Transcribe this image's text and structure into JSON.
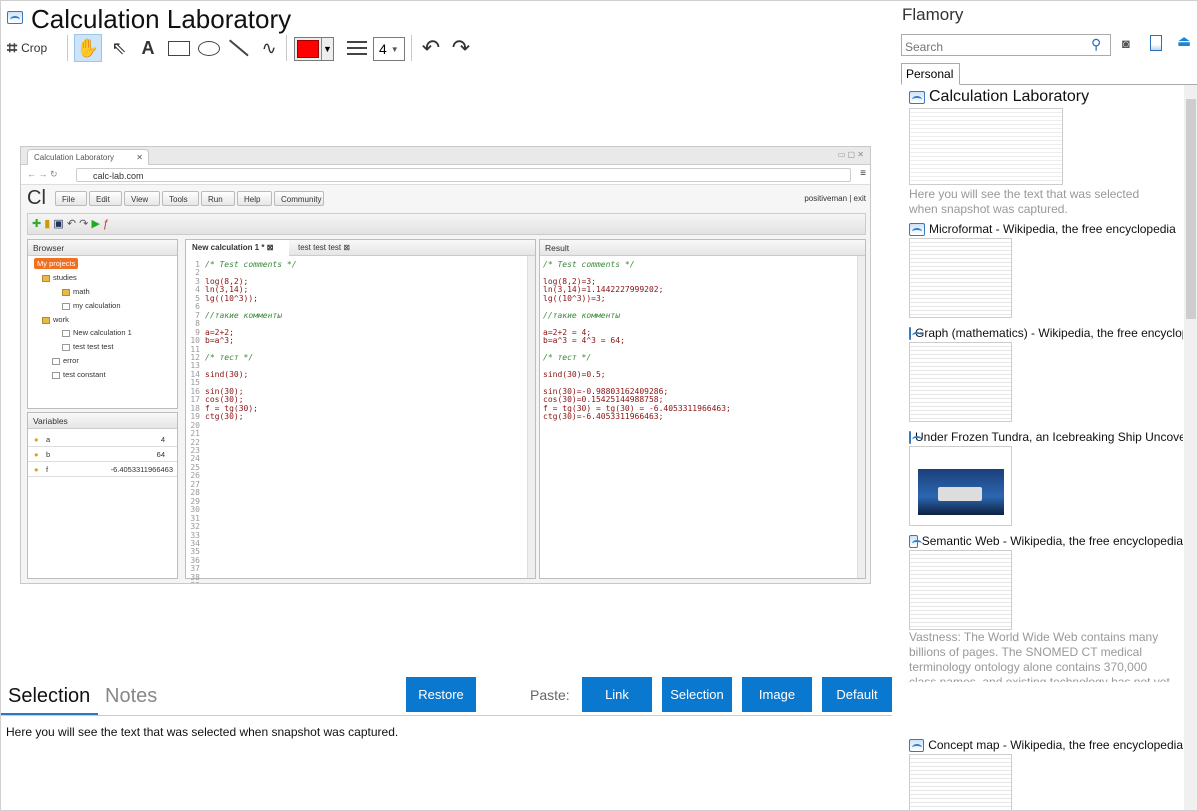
{
  "window": {
    "title": "Calculation Laboratory"
  },
  "toolbar": {
    "crop_label": "Crop",
    "line_width": "4",
    "stroke_color": "#ff0000",
    "icons": [
      "crop-icon",
      "hand-icon",
      "pointer-icon",
      "text-icon",
      "rectangle-icon",
      "ellipse-icon",
      "line-icon",
      "freehand-icon",
      "color-dropdown",
      "line-width-icon",
      "undo-icon",
      "redo-icon"
    ]
  },
  "snapshot": {
    "tab_title": "Calculation Laboratory",
    "url": "calc-lab.com",
    "logo": "Cl",
    "menu": [
      "File",
      "Edit",
      "View",
      "Tools",
      "Run",
      "Help",
      "Community"
    ],
    "user": "positiveman | exit",
    "browser": {
      "header": "Browser",
      "tree": [
        "My projects",
        "studies",
        "math",
        "my calculation",
        "work",
        "New calculation 1",
        "test test test",
        "error",
        "test constant"
      ]
    },
    "variables": {
      "header": "Variables",
      "rows": [
        {
          "name": "a",
          "value": "4"
        },
        {
          "name": "b",
          "value": "64"
        },
        {
          "name": "f",
          "value": "-6.4053311966463"
        }
      ]
    },
    "editor_tabs": [
      "New calculation 1 *",
      "test test test"
    ],
    "editor_lines": [
      "/* Test comments */",
      "",
      "log(8,2);",
      "ln(3,14);",
      "lg((10^3));",
      "",
      "//такие комменты",
      "",
      "a=2+2;",
      "b=a^3;",
      "",
      "/* тест */",
      "",
      "sind(30);",
      "",
      "sin(30);",
      "cos(30);",
      "f = tg(30);",
      "ctg(30);"
    ],
    "line_numbers": [
      "1",
      "2",
      "3",
      "4",
      "5",
      "6",
      "7",
      "8",
      "9",
      "10",
      "11",
      "12",
      "13",
      "14",
      "15",
      "16",
      "17",
      "18",
      "19",
      "20",
      "21",
      "22",
      "23",
      "24",
      "25",
      "26",
      "27",
      "28",
      "29",
      "30",
      "31",
      "32",
      "33",
      "34",
      "35",
      "36",
      "37",
      "38",
      "39"
    ],
    "result": {
      "header": "Result",
      "lines": [
        "/* Test comments */",
        "",
        "log(8,2)=3;",
        "ln(3,14)=1.1442227999202;",
        "lg((10^3))=3;",
        "",
        "//такие комменты",
        "",
        "a=2+2 = 4;",
        "b=a^3 = 4^3 = 64;",
        "",
        "/* тест */",
        "",
        "sind(30)=0.5;",
        "",
        "sin(30)=-0.98803162409286;",
        "cos(30)=0.15425144988758;",
        "f = tg(30) = tg(30) = -6.4053311966463;",
        "ctg(30)=-6.4053311966463;"
      ]
    }
  },
  "bottom": {
    "tabs": [
      "Selection",
      "Notes"
    ],
    "restore": "Restore",
    "paste_label": "Paste:",
    "paste_buttons": [
      "Link",
      "Selection",
      "Image",
      "Default"
    ],
    "selection_text": "Here you will see the text that was selected when snapshot was captured."
  },
  "sidebar": {
    "app_name": "Flamory",
    "search_placeholder": "Search",
    "tab": "Personal",
    "items": [
      {
        "title": "Calculation Laboratory",
        "desc": "Here you will see the text that was selected when snapshot was captured."
      },
      {
        "title": "Microformat - Wikipedia, the free encyclopedia",
        "desc": ""
      },
      {
        "title": "Graph (mathematics) - Wikipedia, the free encyclopedia",
        "desc": ""
      },
      {
        "title": "Under Frozen Tundra, an Icebreaking Ship Uncovers",
        "desc": ""
      },
      {
        "title": "Semantic Web - Wikipedia, the free encyclopedia",
        "desc": "Vastness: The World Wide Web contains many billions of pages. The SNOMED CT medical terminology ontology alone contains 370,000 class names, and existing technology has not yet been able to eliminate all semantically duplicated terms. Any automated reasoning system will have to deal with truly huge inputs."
      },
      {
        "title": "Concept map - Wikipedia, the free encyclopedia",
        "desc": ""
      }
    ]
  }
}
